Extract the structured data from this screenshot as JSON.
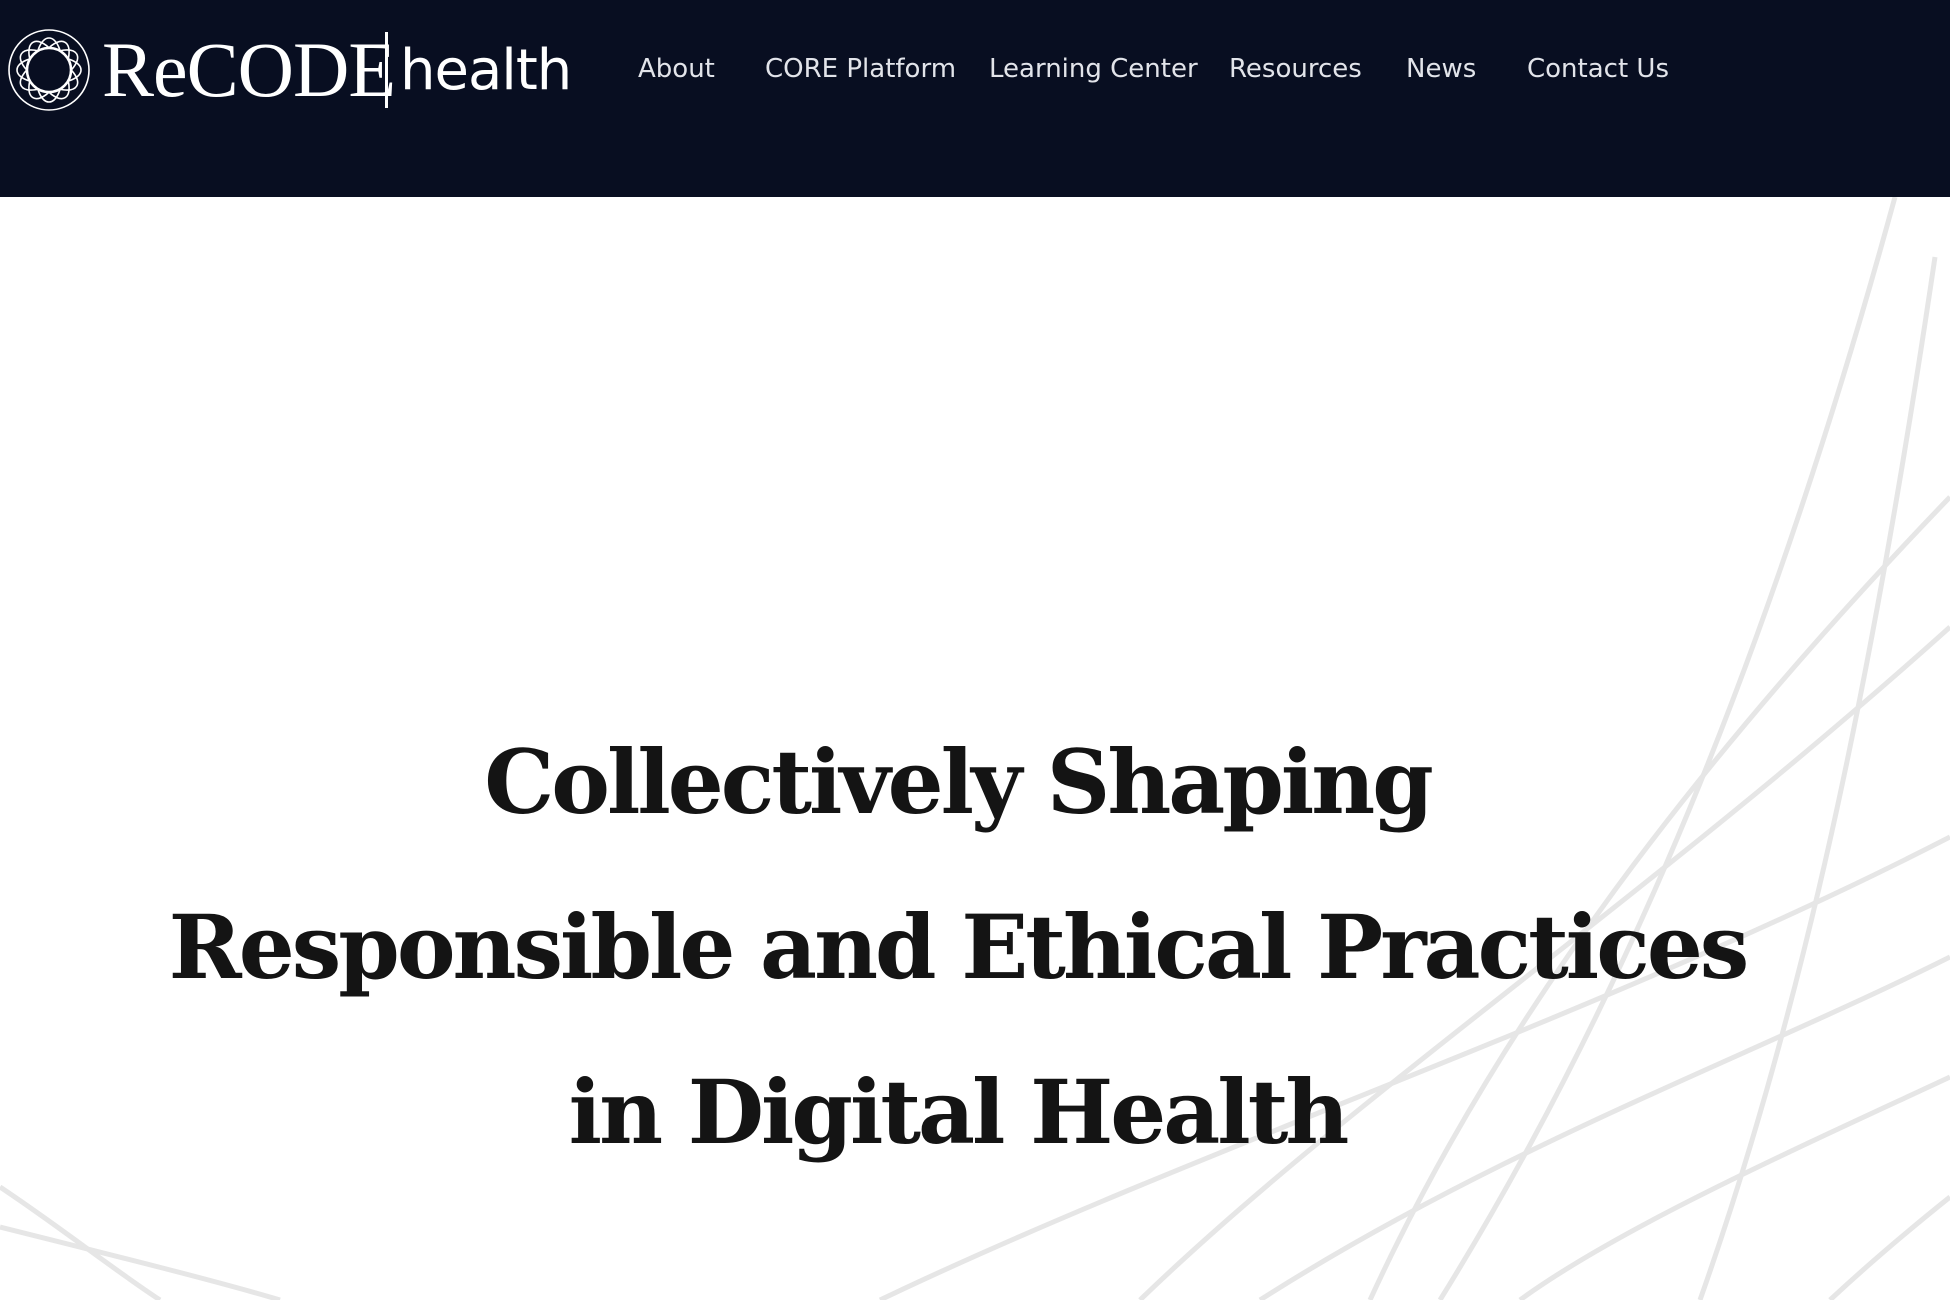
{
  "brand": {
    "name": "ReCODE",
    "suffix": "health"
  },
  "nav": {
    "items": [
      {
        "label": "About"
      },
      {
        "label": "CORE Platform"
      },
      {
        "label": "Learning Center"
      },
      {
        "label": "Resources"
      },
      {
        "label": "News"
      },
      {
        "label": "Contact Us"
      }
    ]
  },
  "hero": {
    "lines": [
      "Collectively Shaping",
      "Responsible and Ethical Practices",
      "in Digital Health"
    ]
  },
  "colors": {
    "header_bg": "#080e21",
    "nav_text": "#e2e4ea",
    "hero_text": "#141414",
    "decor_lines": "#e6e6e6"
  }
}
